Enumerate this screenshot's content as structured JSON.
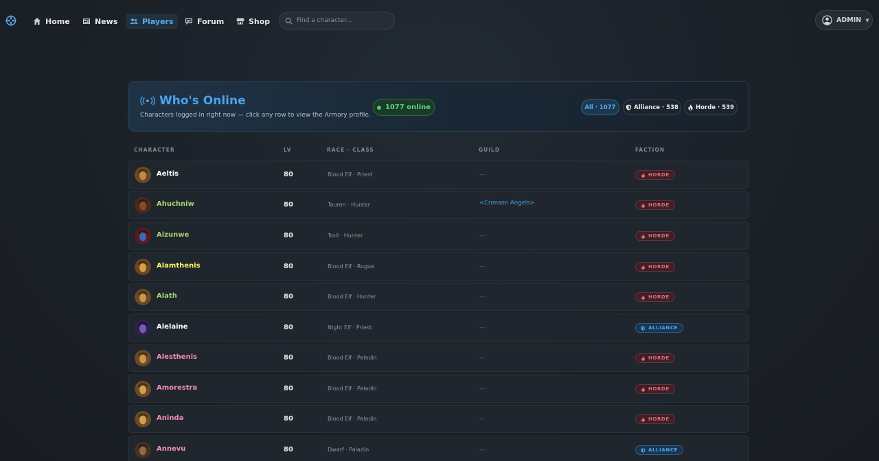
{
  "nav": {
    "logo_icon": "armory-crest-icon",
    "items": [
      {
        "label": "Home",
        "icon": "home-icon"
      },
      {
        "label": "News",
        "icon": "newspaper-icon"
      },
      {
        "label": "Players",
        "icon": "users-icon",
        "active": true
      },
      {
        "label": "Forum",
        "icon": "chat-icon"
      },
      {
        "label": "Shop",
        "icon": "store-icon"
      }
    ],
    "search_placeholder": "Find a character...",
    "user_label": "ADMIN"
  },
  "panel": {
    "title": "Who's Online",
    "subtitle": "Characters logged in right now — click any row to view the Armory profile.",
    "online_count": "1077 online",
    "filters": {
      "all": "All · 1077",
      "alliance": "Alliance · 538",
      "horde": "Horde · 539"
    }
  },
  "table": {
    "headers": {
      "character": "CHARACTER",
      "lv": "LV",
      "race_class": "RACE · CLASS",
      "guild": "GUILD",
      "faction": "FACTION"
    },
    "rows": [
      {
        "name": "Aeltis",
        "level": "80",
        "race_class": "Blood Elf · Priest",
        "guild": "—",
        "faction": "HORDE",
        "class_color": "#ffffff"
      },
      {
        "name": "Ahuchniw",
        "level": "80",
        "race_class": "Tauren · Hunter",
        "guild": "<Crimson Angels>",
        "faction": "HORDE",
        "class_color": "#a9d271"
      },
      {
        "name": "Aizunwe",
        "level": "80",
        "race_class": "Troll · Hunter",
        "guild": "—",
        "faction": "HORDE",
        "class_color": "#a9d271"
      },
      {
        "name": "Alamthenis",
        "level": "80",
        "race_class": "Blood Elf · Rogue",
        "guild": "—",
        "faction": "HORDE",
        "class_color": "#fff468"
      },
      {
        "name": "Alath",
        "level": "80",
        "race_class": "Blood Elf · Hunter",
        "guild": "—",
        "faction": "HORDE",
        "class_color": "#a9d271"
      },
      {
        "name": "Alelaine",
        "level": "80",
        "race_class": "Night Elf · Priest",
        "guild": "—",
        "faction": "ALLIANCE",
        "class_color": "#ffffff"
      },
      {
        "name": "Alesthenis",
        "level": "80",
        "race_class": "Blood Elf · Paladin",
        "guild": "—",
        "faction": "HORDE",
        "class_color": "#f48cba"
      },
      {
        "name": "Amorestra",
        "level": "80",
        "race_class": "Blood Elf · Paladin",
        "guild": "—",
        "faction": "HORDE",
        "class_color": "#f48cba"
      },
      {
        "name": "Aninda",
        "level": "80",
        "race_class": "Blood Elf · Paladin",
        "guild": "—",
        "faction": "HORDE",
        "class_color": "#f48cba"
      },
      {
        "name": "Annevu",
        "level": "80",
        "race_class": "Dwarf · Paladin",
        "guild": "—",
        "faction": "ALLIANCE",
        "class_color": "#f48cba"
      }
    ]
  }
}
